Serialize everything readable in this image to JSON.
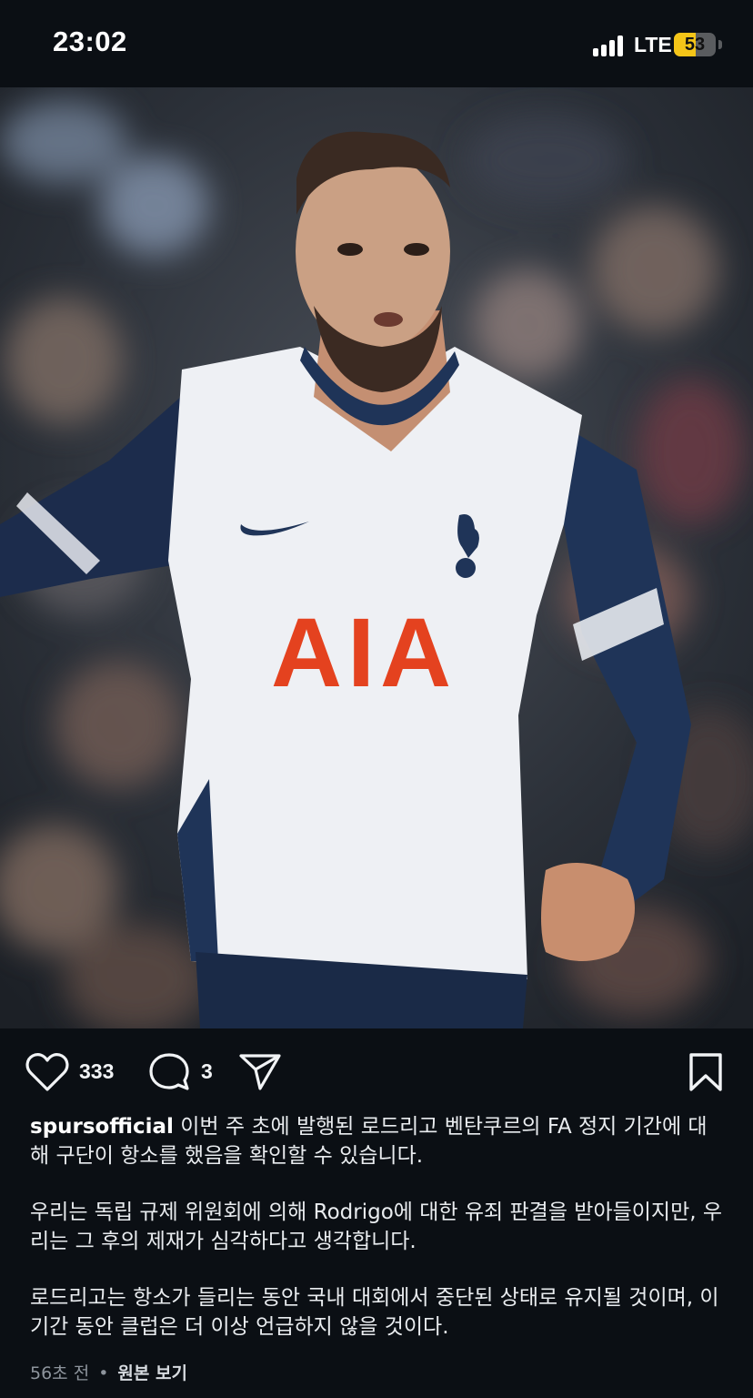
{
  "status_bar": {
    "time": "23:02",
    "network": "LTE",
    "battery_level": "53",
    "battery_fraction": 0.53,
    "battery_color": "#f5c518"
  },
  "post_image": {
    "jersey_sponsor": "AIA"
  },
  "actions": {
    "like_icon": "heart-outline-icon",
    "like_count": "333",
    "comment_icon": "comment-bubble-icon",
    "comment_count": "3",
    "share_icon": "paper-plane-icon",
    "save_icon": "bookmark-outline-icon"
  },
  "caption": {
    "username": "spursofficial",
    "paragraph_1": "이번 주 초에 발행된 로드리고 벤탄쿠르의 FA 정지 기간에 대해 구단이 항소를 했음을 확인할 수 있습니다.",
    "paragraph_2": "우리는 독립 규제 위원회에 의해 Rodrigo에 대한 유죄 판결을 받아들이지만, 우리는 그 후의 제재가 심각하다고 생각합니다.",
    "paragraph_3": "로드리고는 항소가 들리는 동안 국내 대회에서 중단된 상태로 유지될 것이며, 이 기간 동안 클럽은 더 이상 언급하지 않을 것이다."
  },
  "meta": {
    "timestamp": "56초 전",
    "separator": "•",
    "view_original": "원본 보기"
  }
}
